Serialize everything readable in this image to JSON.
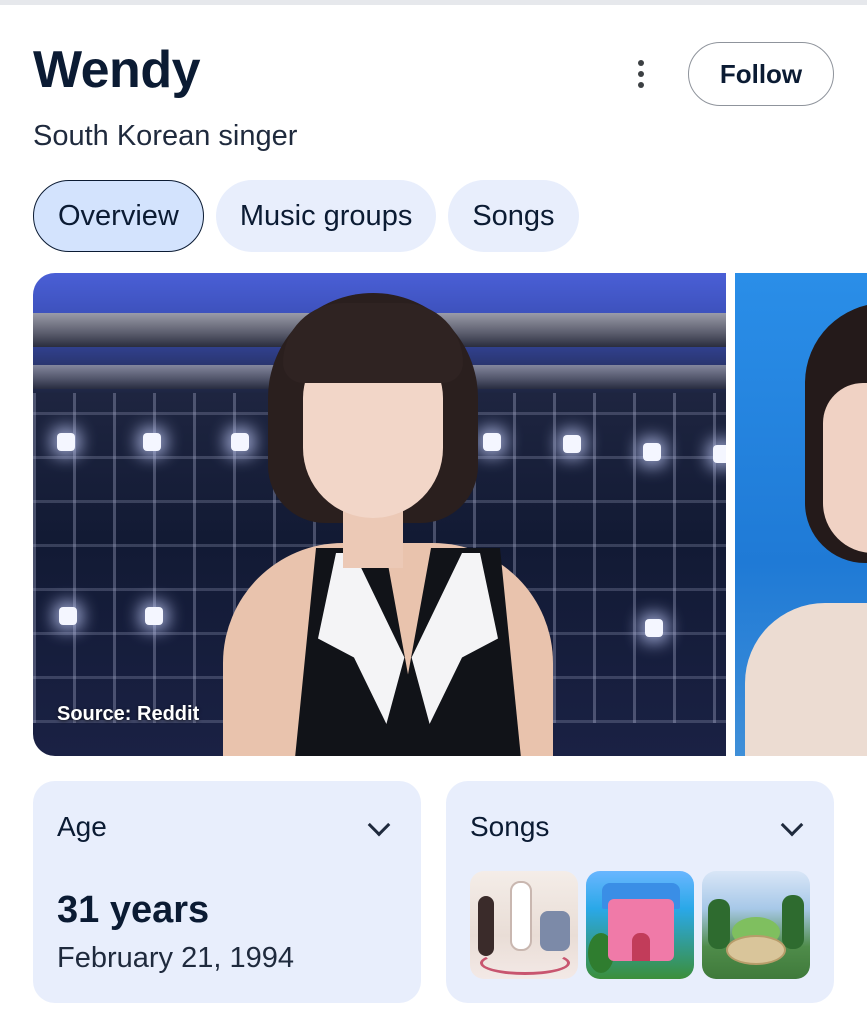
{
  "entity": {
    "name": "Wendy",
    "description": "South Korean singer"
  },
  "header": {
    "follow_label": "Follow",
    "more_icon": "more-vert-icon"
  },
  "tabs": [
    {
      "label": "Overview",
      "active": true
    },
    {
      "label": "Music groups",
      "active": false
    },
    {
      "label": "Songs",
      "active": false
    }
  ],
  "gallery": {
    "source_label": "Source: Reddit"
  },
  "cards": {
    "age": {
      "title": "Age",
      "value": "31 years",
      "date": "February 21, 1994"
    },
    "songs": {
      "title": "Songs",
      "thumbnail_count": 3
    }
  },
  "colors": {
    "chip_bg": "#e8eefc",
    "chip_active_bg": "#d3e3fd",
    "text_primary": "#0b1b33",
    "card_bg": "#e8eefc"
  }
}
